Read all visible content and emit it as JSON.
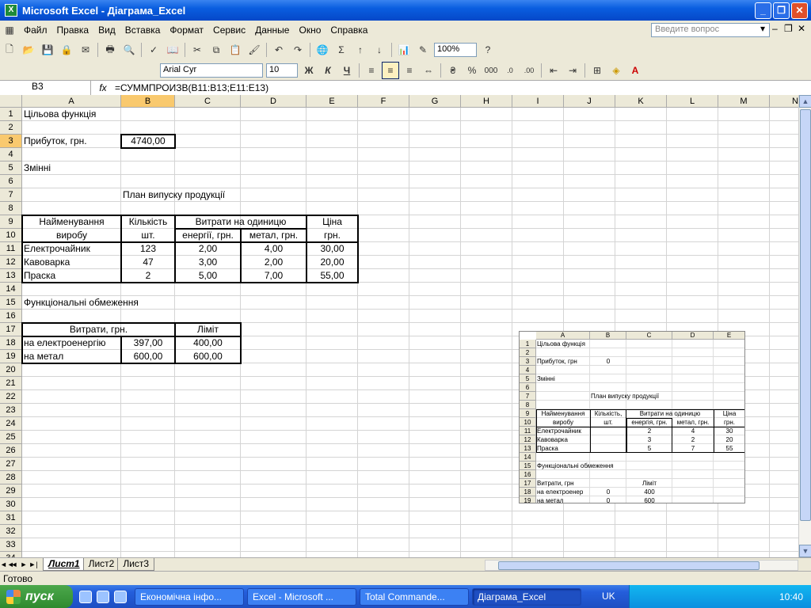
{
  "window": {
    "title": "Microsoft Excel - Діаграма_Excel",
    "min": "_",
    "max": "❐",
    "close": "✕"
  },
  "menu": {
    "items": [
      {
        "label": "Файл",
        "u": "Ф"
      },
      {
        "label": "Правка",
        "u": "П"
      },
      {
        "label": "Вид",
        "u": "В"
      },
      {
        "label": "Вставка",
        "u": "с"
      },
      {
        "label": "Формат",
        "u": "о"
      },
      {
        "label": "Сервис",
        "u": "е"
      },
      {
        "label": "Данные",
        "u": "Д"
      },
      {
        "label": "Окно",
        "u": "О"
      },
      {
        "label": "Справка",
        "u": "С"
      }
    ],
    "help_placeholder": "Введите вопрос"
  },
  "toolbar": {
    "zoom": "100%",
    "font": "Arial Cyr",
    "size": "10",
    "bold": "Ж",
    "italic": "К",
    "underline": "Ч"
  },
  "formula": {
    "namebox": "B3",
    "fx": "fx",
    "text": "=СУММПРОИЗВ(B11:B13;E11:E13)"
  },
  "columns": [
    "A",
    "B",
    "C",
    "D",
    "E",
    "F",
    "G",
    "H",
    "I",
    "J",
    "K",
    "L",
    "M",
    "N"
  ],
  "cells": {
    "a1": "Цільова функція",
    "a3": "Прибуток, грн.",
    "b3": "4740,00",
    "a5": "Змінні",
    "b7": "План випуску продукції",
    "a9": "Найменування",
    "a10": "виробу",
    "b9": "Кількість",
    "b10": "шт.",
    "c9": "Витрати на одиницю",
    "c10": "енергії, грн.",
    "d10": "метал, грн.",
    "e9": "Ціна",
    "e10": "грн.",
    "products": [
      {
        "name": "Електрочайник",
        "qty": "123",
        "energy": "2,00",
        "metal": "4,00",
        "price": "30,00"
      },
      {
        "name": "Кавоварка",
        "qty": "47",
        "energy": "3,00",
        "metal": "2,00",
        "price": "20,00"
      },
      {
        "name": "Праска",
        "qty": "2",
        "energy": "5,00",
        "metal": "7,00",
        "price": "55,00"
      }
    ],
    "a15": "Функціональні обмеження",
    "a17": "Витрати, грн.",
    "c17": "Ліміт",
    "limits": [
      {
        "name": "на електроенергію",
        "value": "397,00",
        "limit": "400,00"
      },
      {
        "name": "на метал",
        "value": "600,00",
        "limit": "600,00"
      }
    ]
  },
  "embedded": {
    "cols": [
      "A",
      "B",
      "C",
      "D",
      "E"
    ],
    "a1": "Цільова функція",
    "a3": "Прибуток, грн",
    "b3": "0",
    "a5": "Змінні",
    "b7": "План випуску продукції",
    "a9": "Найменування",
    "a10": "виробу",
    "b9": "Кількість,",
    "b10": "шт.",
    "c9": "Витрати на одиницю",
    "c10": "енергія, грн.",
    "d10": "метал, грн.",
    "e9": "Ціна",
    "e10": "грн.",
    "products": [
      {
        "name": "Електрочайник",
        "energy": "2",
        "metal": "4",
        "price": "30"
      },
      {
        "name": "Кавоварка",
        "energy": "3",
        "metal": "2",
        "price": "20"
      },
      {
        "name": "Праска",
        "energy": "5",
        "metal": "7",
        "price": "55"
      }
    ],
    "a15": "Функціональні обмеження",
    "a17": "Витрати, грн",
    "c17": "Ліміт",
    "limits": [
      {
        "name": "на електроенер",
        "value": "0",
        "limit": "400"
      },
      {
        "name": "на метал",
        "value": "0",
        "limit": "600"
      }
    ]
  },
  "tabs": {
    "nav": [
      "◄◄",
      "◄",
      "►",
      "►|"
    ],
    "sheets": [
      "Лист1",
      "Лист2",
      "Лист3"
    ],
    "active": 0
  },
  "status": "Готово",
  "taskbar": {
    "start": "пуск",
    "tasks": [
      "Економічна інфо...",
      "Excel - Microsoft ...",
      "Total Commande...",
      "Діаграма_Excel"
    ],
    "lang": "UK",
    "clock": "10:40"
  }
}
